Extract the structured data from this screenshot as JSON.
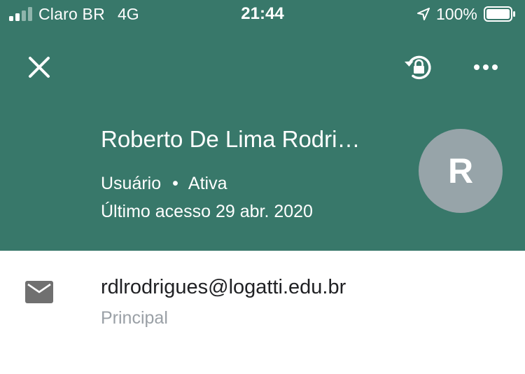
{
  "status_bar": {
    "carrier": "Claro BR",
    "network": "4G",
    "time": "21:44",
    "battery": "100%",
    "icons": [
      "signal-icon",
      "location-arrow-icon",
      "battery-icon"
    ]
  },
  "toolbar": {
    "close_icon": "close-icon",
    "reset_password_icon": "lock-reset-icon",
    "more_icon": "more-horizontal-icon"
  },
  "profile": {
    "name": "Roberto De Lima Rodrigues",
    "role": "Usuário",
    "separator": "•",
    "status": "Ativa",
    "last_access": "Último acesso 29 abr. 2020",
    "avatar_letter": "R"
  },
  "contact": {
    "email_icon": "mail-icon",
    "email": "rdlrodrigues@logatti.edu.br",
    "email_type": "Principal"
  },
  "colors": {
    "header_bg": "#38786A",
    "avatar_bg": "#97A4A9",
    "text_primary": "#202124",
    "text_secondary": "#9AA0A6",
    "icon_gray": "#707070"
  }
}
